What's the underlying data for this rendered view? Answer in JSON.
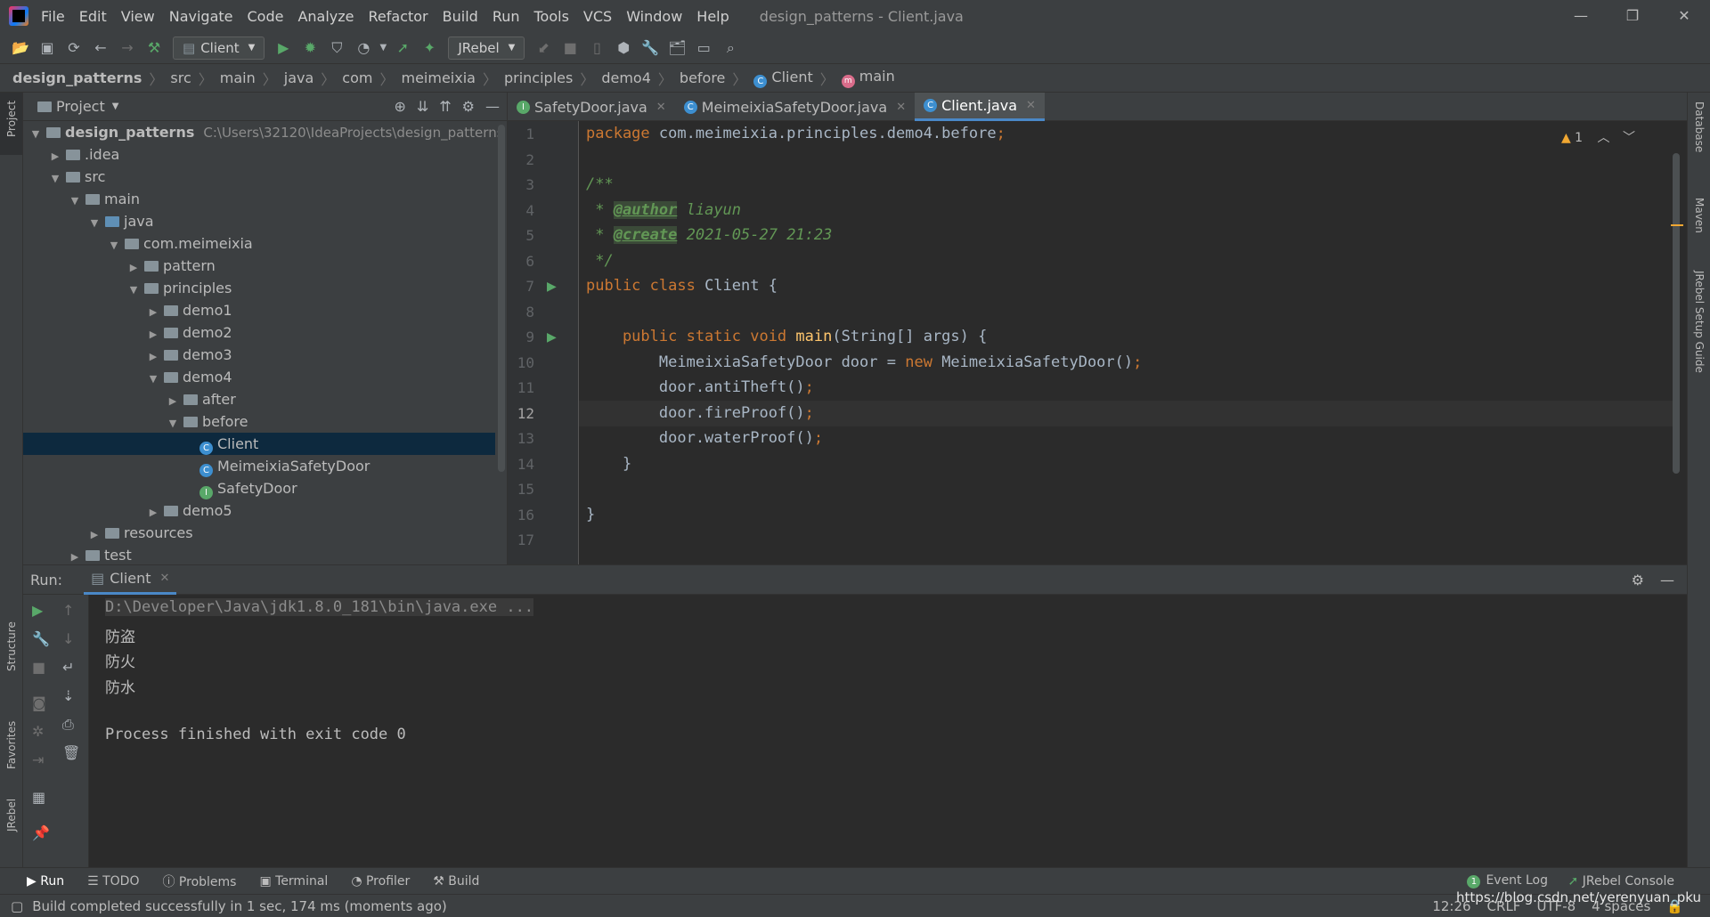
{
  "app": {
    "window_title": "design_patterns - Client.java"
  },
  "menu": [
    "File",
    "Edit",
    "View",
    "Navigate",
    "Code",
    "Analyze",
    "Refactor",
    "Build",
    "Run",
    "Tools",
    "VCS",
    "Window",
    "Help"
  ],
  "window_controls": {
    "minimize": "—",
    "restore": "❐",
    "close": "✕"
  },
  "toolbar": {
    "run_config": "Client",
    "jrebel_label": "JRebel"
  },
  "breadcrumb": [
    "design_patterns",
    "src",
    "main",
    "java",
    "com",
    "meimeixia",
    "principles",
    "demo4",
    "before",
    "Client",
    "main"
  ],
  "left_strip": {
    "project": "Project",
    "structure": "Structure",
    "favorites": "Favorites",
    "jrebel": "JRebel"
  },
  "right_strip": {
    "database": "Database",
    "maven": "Maven",
    "jrebel_guide": "JRebel Setup Guide"
  },
  "project_panel": {
    "title": "Project",
    "root_name": "design_patterns",
    "root_path": "C:\\Users\\32120\\IdeaProjects\\design_patterns",
    "items": [
      ".idea",
      "src",
      "main",
      "java",
      "com.meimeixia",
      "pattern",
      "principles",
      "demo1",
      "demo2",
      "demo3",
      "demo4",
      "after",
      "before",
      "Client",
      "MeimeixiaSafetyDoor",
      "SafetyDoor",
      "demo5",
      "resources",
      "test"
    ]
  },
  "tabs": [
    {
      "label": "SafetyDoor.java",
      "kind": "interface"
    },
    {
      "label": "MeimeixiaSafetyDoor.java",
      "kind": "class"
    },
    {
      "label": "Client.java",
      "kind": "class",
      "active": true
    }
  ],
  "editor": {
    "warnings": "1",
    "current_line": "12",
    "line_numbers": [
      "1",
      "2",
      "3",
      "4",
      "5",
      "6",
      "7",
      "8",
      "9",
      "10",
      "11",
      "12",
      "13",
      "14",
      "15",
      "16",
      "17"
    ],
    "code": {
      "pkg_kw": "package",
      "pkg_name": " com.meimeixia.principles.demo4.before",
      "doc_open": "/**",
      "doc_star": " * ",
      "author_tag": "@author",
      "author_val": " liayun",
      "create_tag": "@create",
      "create_val": " 2021-05-27 21:23",
      "doc_close": " */",
      "public_class": "public class",
      "class_name": " Client {",
      "main_kw": "    public static void",
      "main_name": " main",
      "main_args": "(String[] args) {",
      "l10a": "        MeimeixiaSafetyDoor door = ",
      "l10_new": "new",
      "l10b": " MeimeixiaSafetyDoor()",
      "l11": "        door.antiTheft()",
      "l12": "        door.fireProof()",
      "l13": "        door.waterProof()",
      "semi": ";",
      "l14": "    }",
      "l16": "}"
    }
  },
  "run_panel": {
    "label": "Run:",
    "tab": "Client",
    "console": [
      "D:\\Developer\\Java\\jdk1.8.0_181\\bin\\java.exe ...",
      "防盗",
      "防火",
      "防水",
      "",
      "Process finished with exit code 0"
    ]
  },
  "bottom_tabs": [
    "Run",
    "TODO",
    "Problems",
    "Terminal",
    "Profiler",
    "Build"
  ],
  "bottom_right": {
    "event_log": "Event Log",
    "jrebel_console": "JRebel Console",
    "event_count": "1"
  },
  "status": {
    "message": "Build completed successfully in 1 sec, 174 ms (moments ago)",
    "position": "12:26",
    "line_sep": "CRLF",
    "encoding": "UTF-8",
    "indent": "4 spaces",
    "watermark": "https://blog.csdn.net/yerenyuan_pku"
  },
  "colors": {
    "accent": "#4a88c7",
    "keyword": "#cc7832",
    "doc": "#629755",
    "method": "#ffc66d",
    "run_green": "#59a869",
    "selection": "#0d293e"
  }
}
